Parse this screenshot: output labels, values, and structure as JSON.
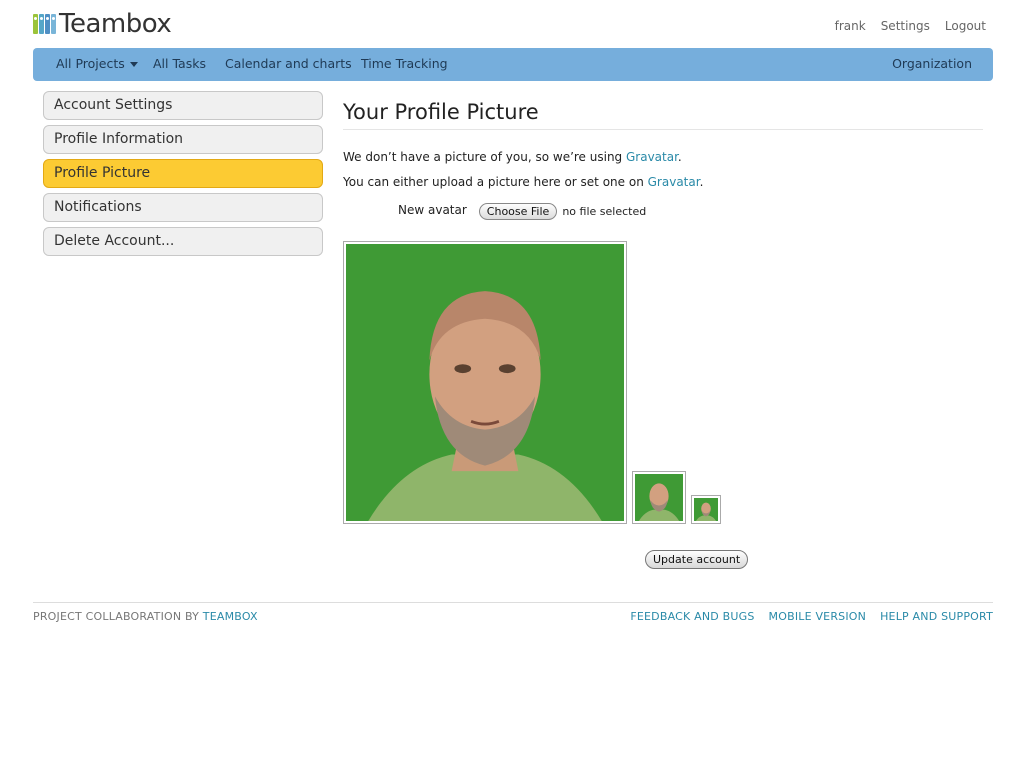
{
  "brand": {
    "name": "Teambox",
    "logo_icon": "binders-icon"
  },
  "top_links": {
    "user": "frank",
    "settings": "Settings",
    "logout": "Logout"
  },
  "nav": {
    "all_projects": "All Projects",
    "all_tasks": "All Tasks",
    "calendar": "Calendar and charts",
    "time_tracking": "Time Tracking",
    "organization": "Organization",
    "bar_color": "#76aedc"
  },
  "sidebar": {
    "items": [
      {
        "label": "Account Settings",
        "active": false
      },
      {
        "label": "Profile Information",
        "active": false
      },
      {
        "label": "Profile Picture",
        "active": true
      },
      {
        "label": "Notifications",
        "active": false
      },
      {
        "label": "Delete Account...",
        "active": false
      }
    ],
    "active_color": "#fccb33"
  },
  "main": {
    "title": "Your Profile Picture",
    "line1_prefix": "We don’t have a picture of you, so we’re using ",
    "line1_link": "Gravatar",
    "line1_suffix": ".",
    "line2_prefix": "You can either upload a picture here or set one on ",
    "line2_link": "Gravatar",
    "line2_suffix": ".",
    "avatar_label": "New avatar",
    "choose_file": "Choose File",
    "file_status": "no file selected",
    "update_button": "Update account"
  },
  "footer": {
    "prefix": "PROJECT COLLABORATION BY ",
    "brand_link": "TEAMBOX",
    "links": [
      "FEEDBACK AND BUGS",
      "MOBILE VERSION",
      "HELP AND SUPPORT"
    ]
  }
}
